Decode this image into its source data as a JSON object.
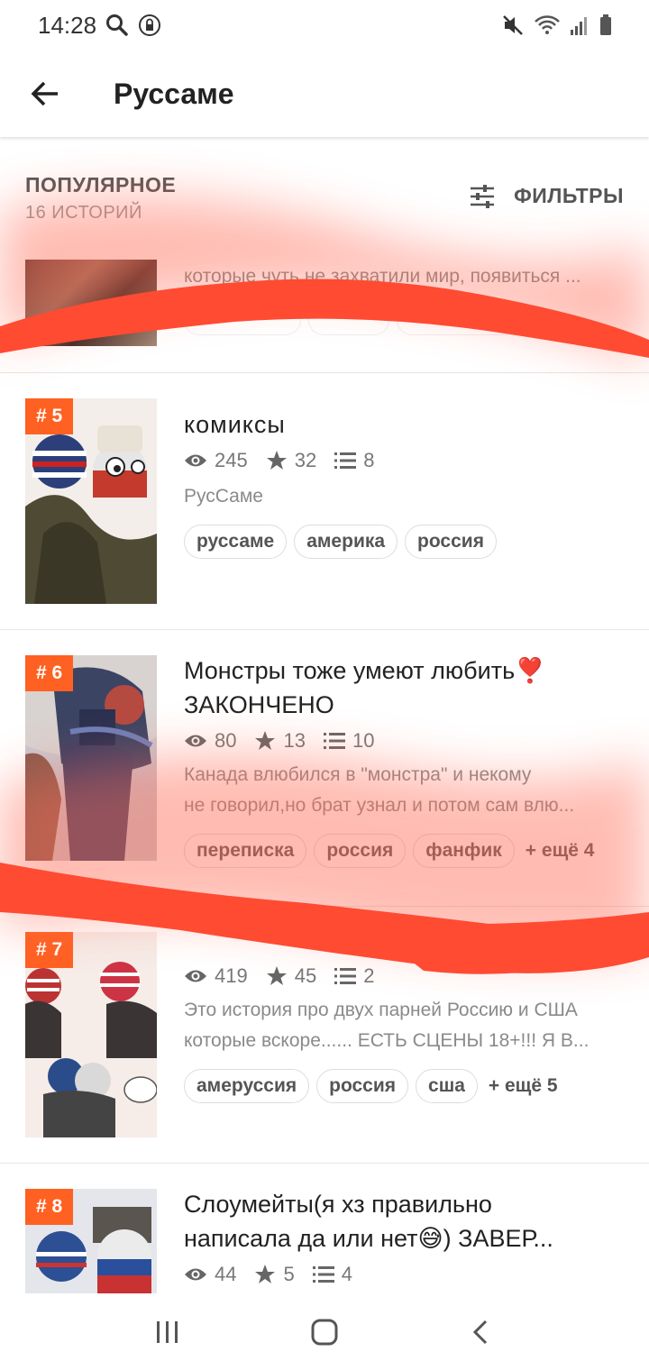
{
  "status_bar": {
    "time": "14:28"
  },
  "app_bar": {
    "title": "Руссаме"
  },
  "section": {
    "title": "ПОПУЛЯРНОЕ",
    "count": "16 ИСТОРИЙ",
    "filters_label": "ФИЛЬТРЫ"
  },
  "stories": [
    {
      "rank": "",
      "title": "",
      "description": "которые чуть не захватили мир, появиться ..."
    },
    {
      "rank": "# 5",
      "title": "комиксы",
      "views": "245",
      "votes": "32",
      "parts": "8",
      "description": "РусСаме",
      "tags": [
        "руссаме",
        "америка",
        "россия"
      ],
      "more": ""
    },
    {
      "rank": "# 6",
      "title": "Монстры тоже умеют любить❣️ ЗАКОНЧЕНО",
      "title_line1": "Монстры тоже умеют любить❣️",
      "title_line2": "ЗАКОНЧЕНО",
      "views": "80",
      "votes": "13",
      "parts": "10",
      "description_line1": "Канада влюбился в \"монстра\" и некому",
      "description_line2": "не говорил,но брат узнал и потом сам влю...",
      "tags": [
        "переписка",
        "россия",
        "фанфик"
      ],
      "more": "+ ещё 4"
    },
    {
      "rank": "# 7",
      "title": "",
      "views": "419",
      "votes": "45",
      "parts": "2",
      "description_line1": "Это история про двух парней Россию и США",
      "description_line2": "которые вскоре...... ЕСТЬ СЦЕНЫ 18+!!! Я В...",
      "tags": [
        "амеруссия",
        "россия",
        "сша"
      ],
      "more": "+ ещё 5"
    },
    {
      "rank": "# 8",
      "title_line1": "Слоумейты(я хз правильно",
      "title_line2": "написала да или нет😅) ЗАВЕР...",
      "views": "44",
      "votes": "5",
      "parts": "4"
    }
  ],
  "colors": {
    "rank_badge": "#ff6122",
    "scribble": "#ff4b32"
  }
}
